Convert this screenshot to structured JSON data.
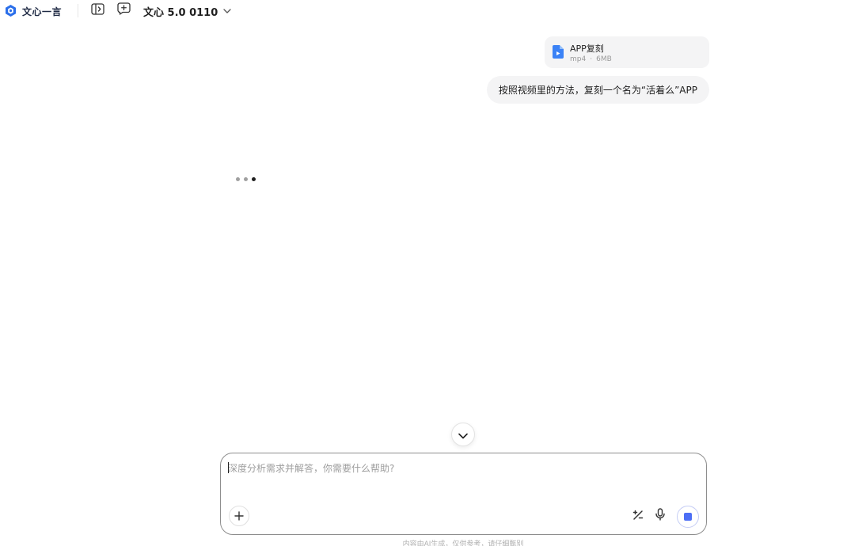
{
  "app": {
    "brand_name": "文心一言",
    "logo_icon": "wenxin-logo-icon",
    "brand_color": "#2b6fea"
  },
  "toolbar": {
    "sidebar_toggle_icon": "sidebar-toggle-icon",
    "new_chat_icon": "new-chat-icon",
    "model_name": "文心 5.0 0110",
    "model_dropdown_icon": "chevron-down-icon"
  },
  "conversation": {
    "attachment": {
      "name": "APP复刻",
      "type": "mp4",
      "separator": "·",
      "size": "6MB",
      "icon": "video-file-icon",
      "icon_color": "#3b82f6"
    },
    "user_message": "按照视频里的方法，复刻一个名为“活着么”APP",
    "loading_state": "typing-dots"
  },
  "scroll_button": {
    "icon": "chevron-down-icon"
  },
  "composer": {
    "placeholder": "深度分析需求并解答，你需要什么帮助?",
    "value": "",
    "add_icon": "plus-icon",
    "tool_icon": "percent-slash-icon",
    "mic_icon": "microphone-icon",
    "stop_icon": "stop-icon",
    "accent_color": "#4c6ef5"
  },
  "footer": {
    "disclaimer": "内容由AI生成，仅供参考，请仔细甄别"
  }
}
